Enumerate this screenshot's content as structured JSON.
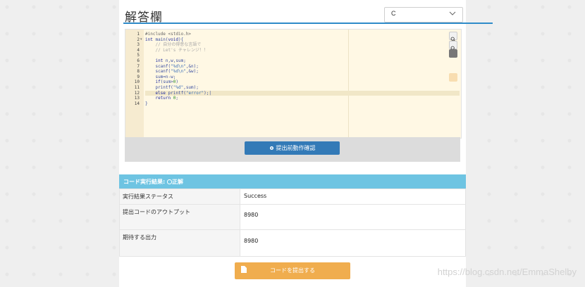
{
  "header": {
    "title": "解答欄"
  },
  "language_select": {
    "value": "C"
  },
  "editor": {
    "lines": [
      {
        "n": "1",
        "fold": "",
        "html": "<span class='tk-pp'>#include &lt;stdio.h&gt;</span>"
      },
      {
        "n": "2",
        "fold": "▾",
        "html": "<span class='tk-kw'>int</span> <span class='tk-plain'>main(</span><span class='tk-kw'>void</span><span class='tk-plain'>){</span>"
      },
      {
        "n": "3",
        "fold": "",
        "html": "    <span class='tk-cm'>// 自分の得意な言語で</span>"
      },
      {
        "n": "4",
        "fold": "",
        "html": "    <span class='tk-cm'>// Let's チャレンジ！！</span>"
      },
      {
        "n": "5",
        "fold": "",
        "html": ""
      },
      {
        "n": "6",
        "fold": "",
        "html": "    <span class='tk-kw'>int</span> <span class='tk-plain'>n,w,sum;</span>"
      },
      {
        "n": "7",
        "fold": "",
        "html": "    <span class='tk-plain'>scanf(</span><span class='tk-str'>\"%d\\n\"</span><span class='tk-plain'>,&amp;n);</span>"
      },
      {
        "n": "8",
        "fold": "",
        "html": "    <span class='tk-plain'>scanf(</span><span class='tk-str'>\"%d\\n\"</span><span class='tk-plain'>,&amp;w);</span>"
      },
      {
        "n": "9",
        "fold": "",
        "html": "    <span class='tk-plain'>sum=n-w;</span>"
      },
      {
        "n": "10",
        "fold": "",
        "html": "    <span class='tk-kw'>if</span><span class='tk-plain'>(sum&gt;</span><span class='tk-num'>0</span><span class='tk-plain'>)</span>"
      },
      {
        "n": "11",
        "fold": "",
        "html": "    <span class='tk-plain'>printf(</span><span class='tk-str'>\"%d\"</span><span class='tk-plain'>,sum);</span>"
      },
      {
        "n": "12",
        "fold": "",
        "html": "    <span class='tk-kw'>else</span> <span class='tk-plain'>printf(</span><span class='tk-str'>\"error\"</span><span class='tk-plain'>);|</span>"
      },
      {
        "n": "13",
        "fold": "",
        "html": "    <span class='tk-kw'>return</span> <span class='tk-num'>0</span><span class='tk-plain'>;</span>"
      },
      {
        "n": "14",
        "fold": "",
        "html": "<span class='tk-plain'>}</span>"
      }
    ],
    "active_line": 12
  },
  "check_button": {
    "label": "提出前動作確認"
  },
  "result": {
    "header_label": "コード実行結果:",
    "verdict": "正解",
    "rows": [
      {
        "key": "実行結果ステータス",
        "value": "Success"
      },
      {
        "key": "提出コードのアウトプット",
        "value": "8980"
      },
      {
        "key": "期待する出力",
        "value": "8980"
      }
    ]
  },
  "submit_button": {
    "label": "コードを提出する"
  },
  "watermark": "https://blog.csdn.net/EmmaShelby",
  "colors": {
    "accent": "#2e8bc9",
    "editor_bg": "#fff8e4",
    "result_header": "#6ec4e2",
    "submit": "#f0ad4e",
    "check": "#337ab7"
  }
}
